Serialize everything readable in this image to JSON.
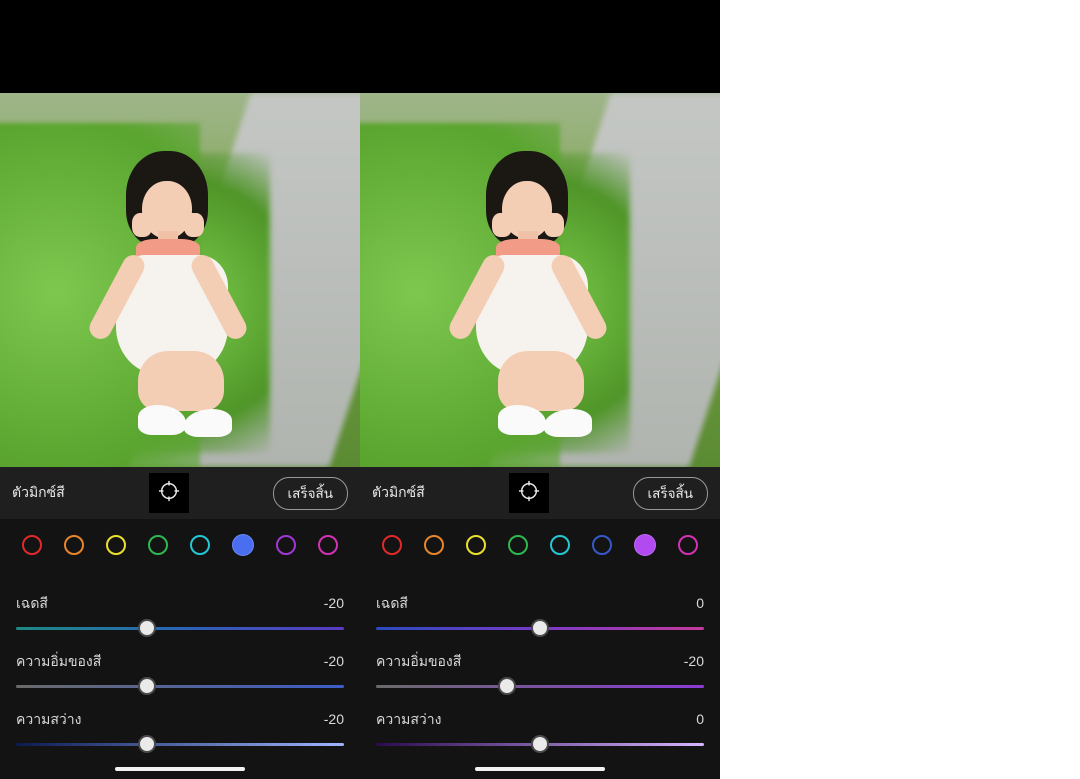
{
  "colors": [
    "red",
    "orange",
    "yellow",
    "green",
    "cyan",
    "blue",
    "purple",
    "magenta"
  ],
  "left": {
    "title": "ตัวมิกซ์สี",
    "doneLabel": "เสร็จสิ้น",
    "selectedColor": "blue",
    "sliders": {
      "hue": {
        "label": "เฉดสี",
        "value": -20,
        "min": -100,
        "max": 100,
        "gradient": "grad-hue-blue"
      },
      "saturation": {
        "label": "ความอิ่มของสี",
        "value": -20,
        "min": -100,
        "max": 100,
        "gradient": "grad-sat-blue"
      },
      "luminance": {
        "label": "ความสว่าง",
        "value": -20,
        "min": -100,
        "max": 100,
        "gradient": "grad-lum-blue"
      }
    }
  },
  "right": {
    "title": "ตัวมิกซ์สี",
    "doneLabel": "เสร็จสิ้น",
    "selectedColor": "purple",
    "sliders": {
      "hue": {
        "label": "เฉดสี",
        "value": 0,
        "min": -100,
        "max": 100,
        "gradient": "grad-hue-purple"
      },
      "saturation": {
        "label": "ความอิ่มของสี",
        "value": -20,
        "min": -100,
        "max": 100,
        "gradient": "grad-sat-purple"
      },
      "luminance": {
        "label": "ความสว่าง",
        "value": 0,
        "min": -100,
        "max": 100,
        "gradient": "grad-lum-purple"
      }
    }
  }
}
